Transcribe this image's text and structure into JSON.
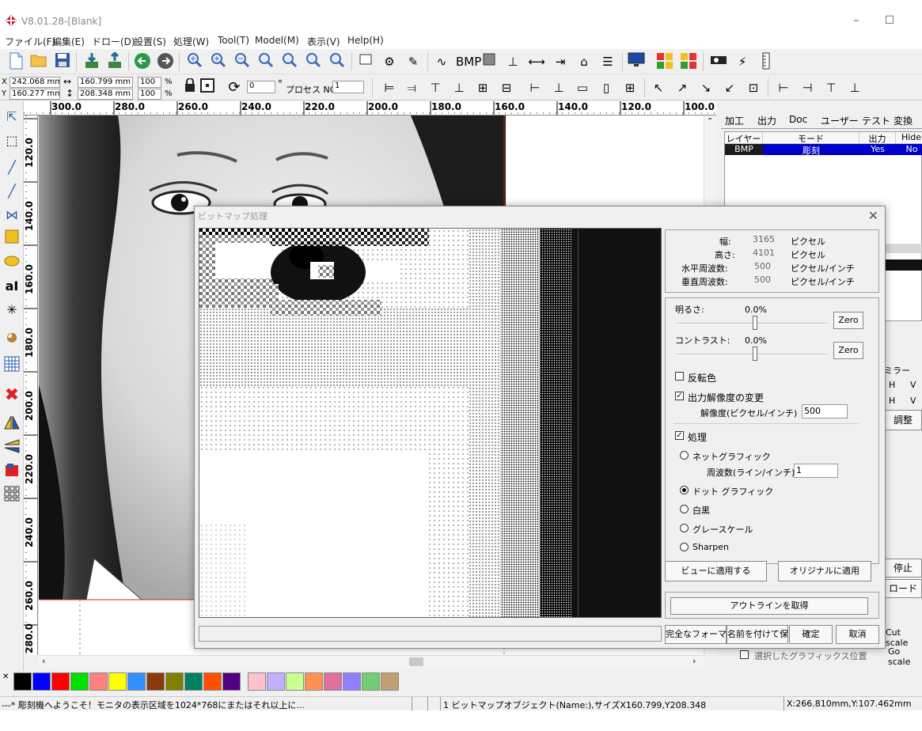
{
  "window": {
    "title": "V8.01.28-[Blank]",
    "minimize": "–",
    "maximize": "☐"
  },
  "menu": [
    "ファイル(F)",
    "編集(E)",
    "ドロー(D)",
    "設置(S)",
    "処理(W)",
    "Tool(T)",
    "Model(M)",
    "表示(V)",
    "Help(H)"
  ],
  "toolbar2": {
    "x_label": "X",
    "y_label": "Y",
    "x_value": "242.068 mm",
    "y_value": "160.277 mm",
    "width_value": "160.799 mm",
    "height_value": "208.348 mm",
    "scale_x": "100",
    "scale_y": "100",
    "percent": "%",
    "rotate_value": "0",
    "degree": "°",
    "process_label": "プロセス NO:",
    "process_value": "1"
  },
  "ruler": {
    "h_ticks": [
      "300.0",
      "280.0",
      "260.0",
      "240.0",
      "220.0",
      "200.0",
      "180.0",
      "160.0",
      "140.0",
      "120.0",
      "100.0"
    ],
    "v_ticks": [
      "120.0",
      "140.0",
      "160.0",
      "180.0",
      "200.0",
      "220.0",
      "240.0",
      "260.0",
      "280.0"
    ]
  },
  "right_panel": {
    "tabs": [
      "加工",
      "出力",
      "Doc",
      "ユーザー",
      "テスト",
      "変換"
    ],
    "columns": [
      "レイヤー",
      "モード",
      "出力",
      "Hide"
    ],
    "row": {
      "layer": "BMP",
      "mode": "彫刻",
      "output": "Yes",
      "hide": "No"
    },
    "mirror_label": "ミラー",
    "mirror_h": "H",
    "mirror_v": "V",
    "adjust": "調整",
    "stop": "停止",
    "load": "ロード",
    "cut_scale": "Cut scale",
    "go_scale": "Go scale",
    "selected_pos": "選択したグラフィックス位置"
  },
  "palette": [
    "#000000",
    "#0000ff",
    "#ff0000",
    "#00e000",
    "#ff8080",
    "#ffff00",
    "#3090ff",
    "#8b3a0a",
    "#808000",
    "#008060",
    "#ff5000",
    "#500080",
    "#ffc0d0",
    "#c0b0ff",
    "#c8ff90",
    "#ff9050",
    "#e070a0",
    "#9080ff",
    "#70d070",
    "#c0a070"
  ],
  "status": {
    "welcome": "---* 彫刻機へようこそ！モニタの表示区域を1024*768にまたはそれ以上に...",
    "object_info": "1 ビットマップオブジェクト(Name:),サイズX160.799,Y208.348",
    "cursor": "X:266.810mm,Y:107.462mm"
  },
  "dialog": {
    "title": "ビットマップ処理",
    "close": "✕",
    "info": {
      "width_label": "幅:",
      "width_value": "3165",
      "width_unit": "ピクセル",
      "height_label": "高さ:",
      "height_value": "4101",
      "height_unit": "ピクセル",
      "hfreq_label": "水平周波数:",
      "hfreq_value": "500",
      "hfreq_unit": "ピクセル/インチ",
      "vfreq_label": "垂直周波数:",
      "vfreq_value": "500",
      "vfreq_unit": "ピクセル/インチ"
    },
    "brightness_label": "明るさ:",
    "brightness_value": "0.0%",
    "contrast_label": "コントラスト:",
    "contrast_value": "0.0%",
    "zero": "Zero",
    "invert_label": "反転色",
    "invert_checked": false,
    "resolution_change_label": "出力解像度の変更",
    "resolution_change_checked": true,
    "resolution_label": "解像度(ピクセル/インチ)",
    "resolution_value": "500",
    "process_label": "処理",
    "process_checked": true,
    "modes": [
      "ネットグラフィック",
      "ドット グラフィック",
      "白黒",
      "グレースケール",
      "Sharpen"
    ],
    "selected_mode": "ドット グラフィック",
    "frequency_label": "周波数(ライン/インチ):",
    "frequency_value": "1",
    "apply_view": "ビューに適用する",
    "apply_original": "オリジナルに適用",
    "get_outline": "アウトラインを取得",
    "full_format": "完全なフォーマット",
    "save_as": "名前を付けて保存",
    "ok": "確定",
    "cancel": "取消"
  }
}
